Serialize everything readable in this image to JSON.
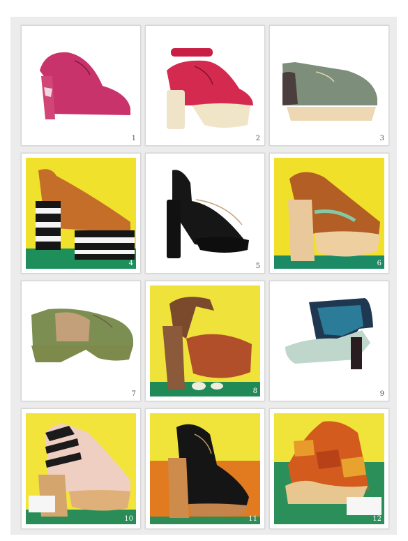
{
  "cards": [
    {
      "number": "1"
    },
    {
      "number": "2"
    },
    {
      "number": "3"
    },
    {
      "number": "4"
    },
    {
      "number": "5"
    },
    {
      "number": "6"
    },
    {
      "number": "7"
    },
    {
      "number": "8"
    },
    {
      "number": "9"
    },
    {
      "number": "10"
    },
    {
      "number": "11"
    },
    {
      "number": "12"
    }
  ]
}
